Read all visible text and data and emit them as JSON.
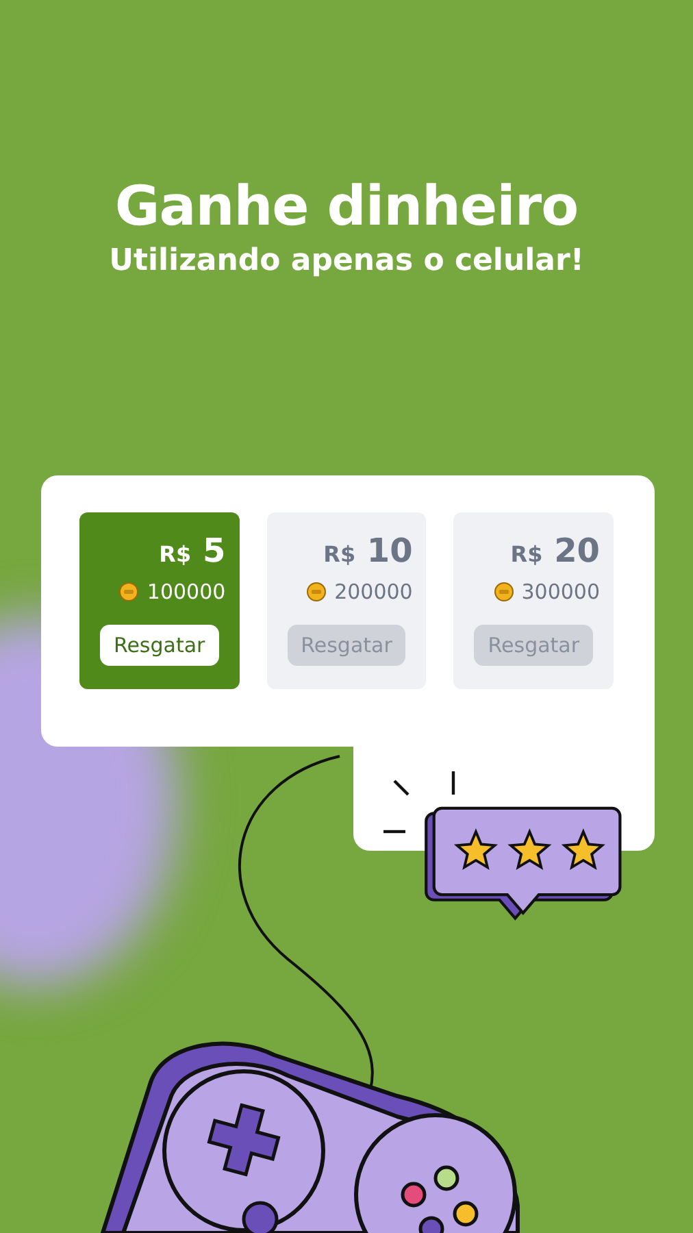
{
  "headline": "Ganhe dinheiro",
  "subheadline": "Utilizando apenas o celular!",
  "rewards": [
    {
      "amount_prefix": "R$",
      "amount": "5",
      "coins": "100000",
      "button": "Resgatar",
      "selected": true
    },
    {
      "amount_prefix": "R$",
      "amount": "10",
      "coins": "200000",
      "button": "Resgatar",
      "selected": false
    },
    {
      "amount_prefix": "R$",
      "amount": "20",
      "coins": "300000",
      "button": "Resgatar",
      "selected": false
    }
  ],
  "rating": {
    "stars": 3
  }
}
